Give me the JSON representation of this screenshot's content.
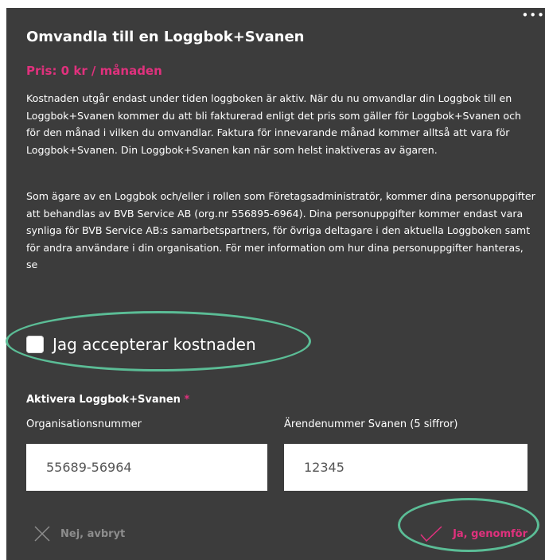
{
  "dialog": {
    "title": "Omvandla till en Loggbok+Svanen",
    "price": "Pris: 0 kr / månaden",
    "paragraph1": "Kostnaden utgår endast under tiden loggboken är aktiv. När du nu omvandlar din Loggbok till en Loggbok+Svanen kommer du att bli fakturerad enligt det pris som gäller för Loggbok+Svanen och för den månad i vilken du omvandlar. Faktura för innevarande månad kommer alltså att vara för Loggbok+Svanen. Din Loggbok+Svanen kan när som helst inaktiveras av ägaren.",
    "paragraph2": "Som ägare av en Loggbok och/eller i rollen som Företagsadministratör, kommer dina personuppgifter att behandlas av BVB Service AB (org.nr 556895-6964). Dina personuppgifter kommer endast vara synliga för BVB Service AB:s samarbetspartners, för övriga deltagare i den aktuella Loggboken samt för andra användare i din organisation. För mer information om hur dina personuppgifter hanteras, se",
    "more_menu": "•••",
    "accept_label": "Jag accepterar kostnaden",
    "activate_label": "Aktivera Loggbok+Svanen",
    "required_mark": "*",
    "org_label": "Organisationsnummer",
    "org_value": "55689-56964",
    "case_label": "Ärendenummer Svanen (5 siffror)",
    "case_value": "12345",
    "cancel_label": "Nej, avbryt",
    "confirm_label": "Ja, genomför"
  },
  "colors": {
    "background": "#3c3c3c",
    "accent": "#e0317d",
    "highlight": "#5bbd96"
  }
}
